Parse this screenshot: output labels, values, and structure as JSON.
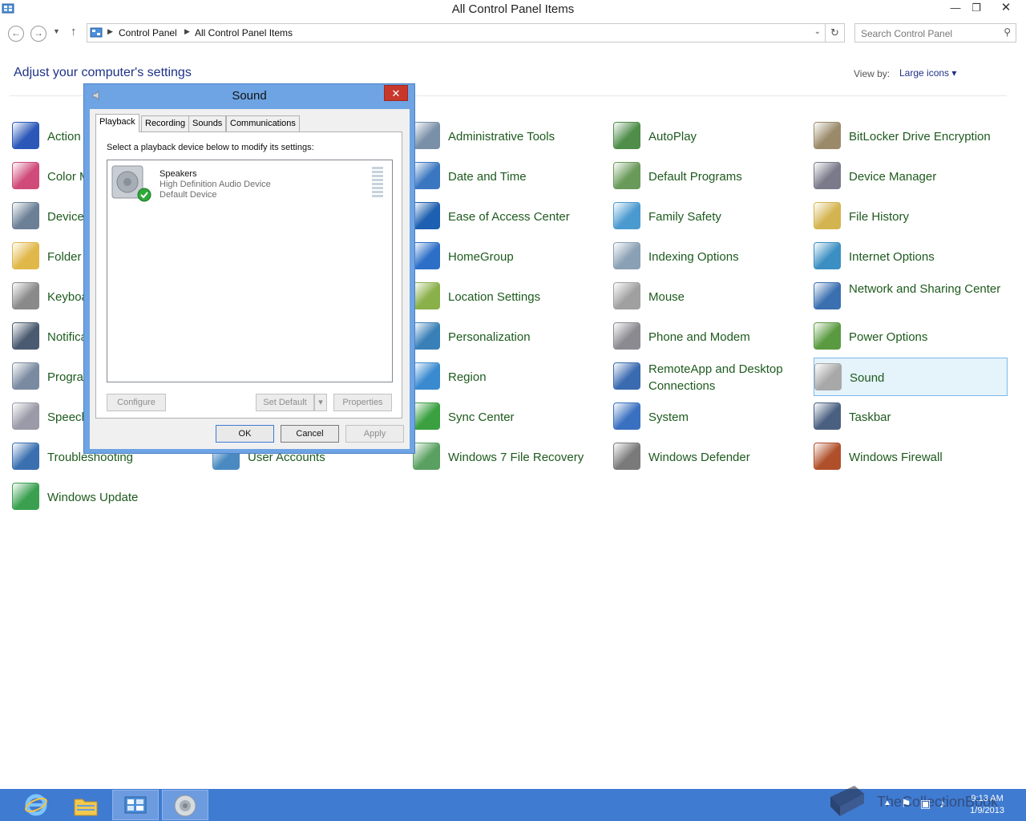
{
  "window": {
    "title": "All Control Panel Items",
    "minimize": "—",
    "restore": "❐",
    "close": "✕"
  },
  "address": {
    "crumbs": [
      "Control Panel",
      "All Control Panel Items"
    ],
    "search_placeholder": "Search Control Panel"
  },
  "header": {
    "heading": "Adjust your computer's settings",
    "view_by_label": "View by:",
    "view_by_value": "Large icons ▾"
  },
  "items": [
    {
      "label": "Action Center",
      "color": "#2a57b8"
    },
    {
      "label": "Administrative Tools",
      "color": "#7a8fa8"
    },
    {
      "label": "AutoPlay",
      "color": "#4f8d4a"
    },
    {
      "label": "BitLocker Drive Encryption",
      "color": "#9a8a6a"
    },
    {
      "label": "Color Management",
      "color": "#d04a7a"
    },
    {
      "label": "Date and Time",
      "color": "#3a77c0"
    },
    {
      "label": "Default Programs",
      "color": "#6a9a5a"
    },
    {
      "label": "Device Manager",
      "color": "#7a7a8a"
    },
    {
      "label": "Devices and Printers",
      "color": "#6b7f95"
    },
    {
      "label": "Ease of Access Center",
      "color": "#1d5fb0"
    },
    {
      "label": "Family Safety",
      "color": "#4a9ad0"
    },
    {
      "label": "File History",
      "color": "#d4b450"
    },
    {
      "label": "Folder Options",
      "color": "#e0b84a"
    },
    {
      "label": "HomeGroup",
      "color": "#2d6fc7"
    },
    {
      "label": "Indexing Options",
      "color": "#8aa0b4"
    },
    {
      "label": "Internet Options",
      "color": "#3b8fc2"
    },
    {
      "label": "Keyboard",
      "color": "#8a8a8a"
    },
    {
      "label": "Location Settings",
      "color": "#8ab04a"
    },
    {
      "label": "Mouse",
      "color": "#a0a0a0"
    },
    {
      "label": "Network and Sharing Center",
      "color": "#3a6fb0"
    },
    {
      "label": "Notification Area Icons",
      "color": "#4a5a70"
    },
    {
      "label": "Personalization",
      "color": "#3a80b8"
    },
    {
      "label": "Phone and Modem",
      "color": "#8a8a90"
    },
    {
      "label": "Power Options",
      "color": "#5a9a40"
    },
    {
      "label": "Programs and Features",
      "color": "#7a8aa0"
    },
    {
      "label": "Region",
      "color": "#3a8ad0"
    },
    {
      "label": "RemoteApp and Desktop Connections",
      "color": "#3a6ab0"
    },
    {
      "label": "Sound",
      "color": "#a8a8a8"
    },
    {
      "label": "Speech Recognition",
      "color": "#9a9aa8"
    },
    {
      "label": "Sync Center",
      "color": "#3aa040"
    },
    {
      "label": "System",
      "color": "#3a70c0"
    },
    {
      "label": "Taskbar",
      "color": "#4a6080"
    },
    {
      "label": "Troubleshooting",
      "color": "#3a70b0"
    },
    {
      "label": "User Accounts",
      "color": "#4a8ac0"
    },
    {
      "label": "Windows 7 File Recovery",
      "color": "#5aa060"
    },
    {
      "label": "Windows Defender",
      "color": "#7a7a7a"
    },
    {
      "label": "Windows Firewall",
      "color": "#b0502a"
    },
    {
      "label": "Windows Update",
      "color": "#3aa050"
    }
  ],
  "dialog": {
    "title": "Sound",
    "close": "✕",
    "tabs": [
      "Playback",
      "Recording",
      "Sounds",
      "Communications"
    ],
    "instruction": "Select a playback device below to modify its settings:",
    "device": {
      "name": "Speakers",
      "driver": "High Definition Audio Device",
      "status": "Default Device"
    },
    "buttons": {
      "configure": "Configure",
      "set_default": "Set Default",
      "properties": "Properties",
      "ok": "OK",
      "cancel": "Cancel",
      "apply": "Apply"
    }
  },
  "taskbar": {
    "time": "9:13 AM",
    "date": "1/9/2013",
    "watermark": "TheCollectionBook"
  }
}
